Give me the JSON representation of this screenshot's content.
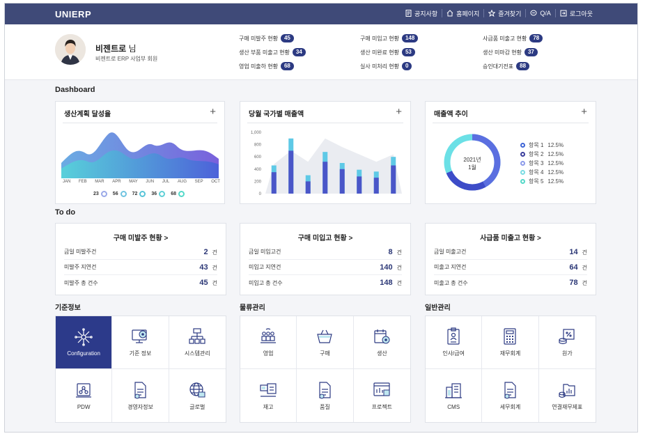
{
  "app": {
    "logo": "UNIERP"
  },
  "topmenu": [
    {
      "label": "공지사항",
      "icon": "notice-icon"
    },
    {
      "label": "홈페이지",
      "icon": "home-icon"
    },
    {
      "label": "즐겨찾기",
      "icon": "star-icon"
    },
    {
      "label": "Q/A",
      "icon": "chat-icon"
    },
    {
      "label": "로그아웃",
      "icon": "logout-icon"
    }
  ],
  "user": {
    "name": "비젠트로",
    "honorific": "님",
    "sub": "비젠트로 ERP 사업부 회원"
  },
  "stats": [
    {
      "label": "구매 미발주 현황",
      "value": "45"
    },
    {
      "label": "구매 미입고 현황",
      "value": "148"
    },
    {
      "label": "사급품 미출고 현황",
      "value": "78"
    },
    {
      "label": "생산 부품 미출고 현황",
      "value": "34"
    },
    {
      "label": "생산 미완료 현황",
      "value": "53"
    },
    {
      "label": "생산 미마감 현황",
      "value": "37"
    },
    {
      "label": "영업 미출하 현황",
      "value": "68"
    },
    {
      "label": "실사 미처리 현황",
      "value": "0"
    },
    {
      "label": "승인대기전표",
      "value": "88"
    }
  ],
  "dashboard": {
    "title": "Dashboard",
    "card1": {
      "title": "생산계획 달성율",
      "months": [
        "JAN",
        "FEB",
        "MAR",
        "APR",
        "MAY",
        "JUN",
        "JUL",
        "AUG",
        "SEP",
        "OCT"
      ],
      "markers": [
        "23",
        "56",
        "72",
        "36",
        "68"
      ]
    },
    "card2": {
      "title": "당월 국가별 매출액"
    },
    "card3": {
      "title": "매출액 추이",
      "center1": "2021년",
      "center2": "1월",
      "legend": [
        {
          "label": "항목 1",
          "pct": "12.5%",
          "color": "#3d64d6"
        },
        {
          "label": "항목 2",
          "pct": "12.5%",
          "color": "#3a3d9c"
        },
        {
          "label": "항목 3",
          "pct": "12.5%",
          "color": "#8c9bea"
        },
        {
          "label": "항목 4",
          "pct": "12.5%",
          "color": "#7adce3"
        },
        {
          "label": "항목 5",
          "pct": "12.5%",
          "color": "#53d8c8"
        }
      ]
    }
  },
  "chart_data": {
    "type": "bar",
    "y_ticks": [
      "1,000",
      "800",
      "600",
      "400",
      "200",
      "0"
    ],
    "ylim": [
      0,
      1000
    ],
    "series": [
      {
        "values": [
          460,
          900,
          300,
          680,
          500,
          390,
          360,
          600
        ]
      },
      {
        "values": [
          350,
          700,
          200,
          520,
          400,
          280,
          260,
          460
        ]
      }
    ],
    "background_area": [
      480,
      700,
      520,
      900,
      760,
      640,
      520,
      640
    ]
  },
  "todo": {
    "title": "To do",
    "cards": [
      {
        "title": "구매 미발주 현황 >",
        "rows": [
          {
            "label": "금일 미발주건",
            "value": "2",
            "unit": "건"
          },
          {
            "label": "미발주 지연건",
            "value": "43",
            "unit": "건"
          },
          {
            "label": "미발주 총 건수",
            "value": "45",
            "unit": "건"
          }
        ]
      },
      {
        "title": "구매 미입고 현황 >",
        "rows": [
          {
            "label": "금일 미입고건",
            "value": "8",
            "unit": "건"
          },
          {
            "label": "미입고 지연건",
            "value": "140",
            "unit": "건"
          },
          {
            "label": "미입고 총 건수",
            "value": "148",
            "unit": "건"
          }
        ]
      },
      {
        "title": "사급품 미출고 현황 >",
        "rows": [
          {
            "label": "금일 미출고건",
            "value": "14",
            "unit": "건"
          },
          {
            "label": "미출고 지연건",
            "value": "64",
            "unit": "건"
          },
          {
            "label": "미출고 총 건수",
            "value": "78",
            "unit": "건"
          }
        ]
      }
    ]
  },
  "menus": [
    {
      "title": "기준정보",
      "items": [
        {
          "label": "Configuration",
          "icon": "configuration-icon"
        },
        {
          "label": "기준 정보",
          "icon": "monitor-gear-icon"
        },
        {
          "label": "시스템관리",
          "icon": "org-chart-icon"
        },
        {
          "label": "PDW",
          "icon": "pdw-icon"
        },
        {
          "label": "경영자정보",
          "icon": "document-icon"
        },
        {
          "label": "글로벌",
          "icon": "globe-icon"
        }
      ]
    },
    {
      "title": "물류관리",
      "items": [
        {
          "label": "영업",
          "icon": "people-icon"
        },
        {
          "label": "구매",
          "icon": "basket-icon"
        },
        {
          "label": "생산",
          "icon": "production-icon"
        },
        {
          "label": "재고",
          "icon": "inventory-icon"
        },
        {
          "label": "품질",
          "icon": "quality-icon"
        },
        {
          "label": "프로젝트",
          "icon": "project-icon"
        }
      ]
    },
    {
      "title": "일반관리",
      "items": [
        {
          "label": "인사/급여",
          "icon": "id-card-icon"
        },
        {
          "label": "재무회계",
          "icon": "calculator-icon"
        },
        {
          "label": "원가",
          "icon": "cost-icon"
        },
        {
          "label": "CMS",
          "icon": "building-icon"
        },
        {
          "label": "세무회계",
          "icon": "tax-icon"
        },
        {
          "label": "연결재무제표",
          "icon": "folder-chart-icon"
        }
      ]
    }
  ]
}
